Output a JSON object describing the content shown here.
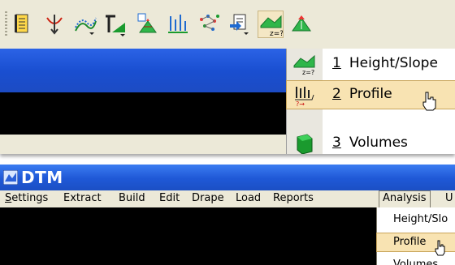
{
  "toolbar": {
    "buttons": [
      {
        "icon": "report-book-icon"
      },
      {
        "icon": "drape-icon"
      },
      {
        "icon": "contour-icon"
      },
      {
        "icon": "slope-triangle-icon"
      },
      {
        "icon": "triangle-grid-icon"
      },
      {
        "icon": "vertical-profile-icon"
      },
      {
        "icon": "point-scatter-icon"
      },
      {
        "icon": "export-icon"
      },
      {
        "icon": "analysis-height-slope-icon"
      },
      {
        "icon": "triangle-analysis-icon"
      }
    ]
  },
  "dropdown": {
    "items": [
      {
        "number": "1",
        "label": "Height/Slope",
        "icon": "height-slope-icon"
      },
      {
        "number": "2",
        "label": "Profile",
        "icon": "profile-icon",
        "selected": true
      },
      {
        "number": "3",
        "label": "Volumes",
        "icon": "volumes-icon"
      }
    ]
  },
  "window": {
    "title": "DTM",
    "menu": [
      {
        "label": "Settings"
      },
      {
        "label": "Extract"
      },
      {
        "label": "Build"
      },
      {
        "label": "Edit"
      },
      {
        "label": "Drape"
      },
      {
        "label": "Load"
      },
      {
        "label": "Reports"
      },
      {
        "label": "Analysis",
        "open": true
      },
      {
        "label": "U"
      }
    ],
    "analysis_menu": [
      {
        "label": "Height/Slo"
      },
      {
        "label": "Profile",
        "selected": true
      },
      {
        "label": "Volumes"
      }
    ]
  },
  "colors": {
    "titlebar_blue": "#1f58d6",
    "menu_bg": "#ece9d8",
    "highlight": "#f8e3b2"
  }
}
